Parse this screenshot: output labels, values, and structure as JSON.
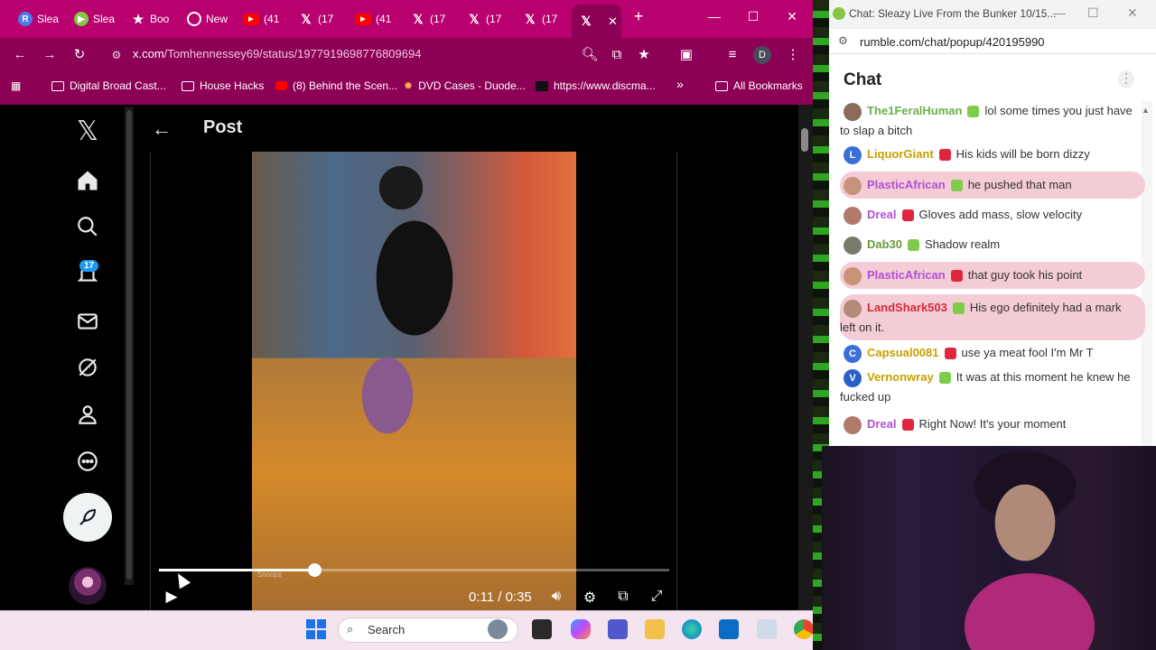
{
  "browser": {
    "tabs": [
      {
        "label": "Slea",
        "icon": "rumble-icon",
        "color": "#4b7bec"
      },
      {
        "label": "Slea",
        "icon": "rumble-play-icon",
        "color": "#85c742"
      },
      {
        "label": "Boo",
        "icon": "star-icon",
        "color": "#ffffff"
      },
      {
        "label": "New",
        "icon": "chrome-icon",
        "color": "#ffffff"
      },
      {
        "label": "(41",
        "icon": "youtube-icon",
        "color": "#ff0000"
      },
      {
        "label": "(17",
        "icon": "x-icon",
        "color": "#ffffff"
      },
      {
        "label": "(41",
        "icon": "youtube-icon",
        "color": "#ff0000"
      },
      {
        "label": "(17",
        "icon": "x-icon",
        "color": "#ffffff"
      },
      {
        "label": "(17",
        "icon": "x-icon",
        "color": "#ffffff"
      },
      {
        "label": "(17",
        "icon": "x-icon",
        "color": "#ffffff"
      },
      {
        "label": "",
        "icon": "x-icon",
        "color": "#ffffff"
      }
    ],
    "url_main": "x.com",
    "url_path": "/Tomhennessey69/status/1977919698776809694",
    "profile_initial": "D",
    "bookmarks": [
      {
        "label": "Digital Broad Cast...",
        "icon": "folder-icon"
      },
      {
        "label": "House Hacks",
        "icon": "folder-icon"
      },
      {
        "label": "(8) Behind the Scen...",
        "icon": "youtube-icon"
      },
      {
        "label": "DVD Cases - Duode...",
        "icon": "bookmark-icon"
      },
      {
        "label": "https://www.discma...",
        "icon": "bookmark-icon"
      },
      {
        "label": "»",
        "icon": "more-icon"
      },
      {
        "label": "All Bookmarks",
        "icon": "folder-icon"
      }
    ]
  },
  "x": {
    "notifications_badge": "17",
    "post_title": "Post",
    "video": {
      "current_time": "0:11",
      "duration": "0:35",
      "time_text": "0:11 / 0:35",
      "progress": 0.305,
      "watermark": "Snoopz"
    }
  },
  "taskbar": {
    "search_placeholder": "Search"
  },
  "chat": {
    "window_title": "Chat: Sleazy Live From the Bunker 10/15...",
    "url": "rumble.com/chat/popup/420195990",
    "header": "Chat",
    "messages": [
      {
        "user": "The1FeralHuman",
        "text": "lol some times you just have to slap a bitch",
        "color": "#6ab04c",
        "avatar": "#8a6a5a",
        "initial": "",
        "highlight": false
      },
      {
        "user": "LiquorGiant",
        "text": "His kids will be born dizzy",
        "color": "#c8a000",
        "avatar": "#3b6fd8",
        "initial": "L",
        "highlight": false
      },
      {
        "user": "PlasticAfrican",
        "text": "he pushed that man",
        "color": "#b150d8",
        "avatar": "#c59478",
        "initial": "",
        "highlight": true
      },
      {
        "user": "Dreal",
        "text": "Gloves add mass, slow velocity",
        "color": "#b150d8",
        "avatar": "#b07a6a",
        "initial": "",
        "highlight": false
      },
      {
        "user": "Dab30",
        "text": "Shadow realm",
        "color": "#6a9a3a",
        "avatar": "#7a7a6a",
        "initial": "",
        "highlight": false
      },
      {
        "user": "PlasticAfrican",
        "text": "that guy took his point",
        "color": "#b150d8",
        "avatar": "#c59478",
        "initial": "",
        "highlight": true
      },
      {
        "user": "LandShark503",
        "text": "His ego definitely had a mark left on it.",
        "color": "#d82a3a",
        "avatar": "#b48a7a",
        "initial": "",
        "highlight": true
      },
      {
        "user": "Capsual0081",
        "text": "use ya meat fool I'm Mr T",
        "color": "#c8a000",
        "avatar": "#3b6fd8",
        "initial": "C",
        "highlight": false
      },
      {
        "user": "Vernonwray",
        "text": "It was at this moment he knew he fucked up",
        "color": "#c8a000",
        "avatar": "#2a5fc8",
        "initial": "V",
        "highlight": false
      },
      {
        "user": "Dreal",
        "text": "Right Now! It's your moment",
        "color": "#b150d8",
        "avatar": "#b07a6a",
        "initial": "",
        "highlight": false
      }
    ]
  },
  "colors": {
    "chrome_pink": "#b8006e",
    "x_blue": "#1d9bf0",
    "rumble_green": "#85c742"
  }
}
